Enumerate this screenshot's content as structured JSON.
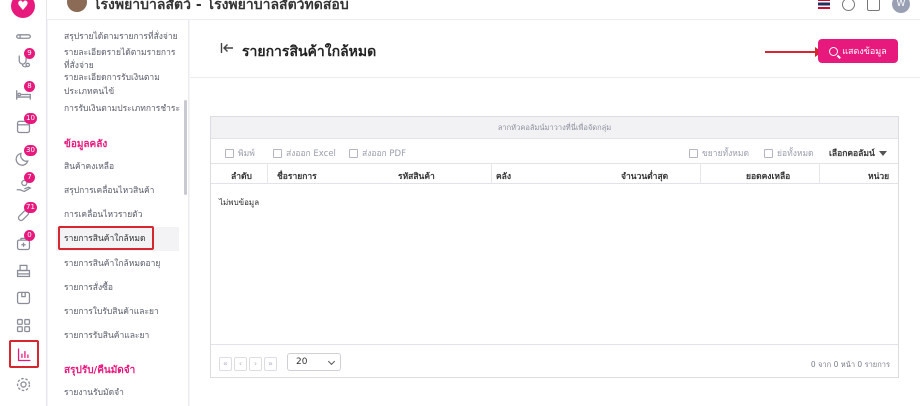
{
  "topbar": {
    "hospital_title": "โรงพยาบาลสัตว์ - โรงพยาบาลสัตว์ทดสอบ",
    "user_initial": "W"
  },
  "rail": {
    "badges": [
      "9",
      "8",
      "10",
      "30",
      "7",
      "71",
      "0"
    ]
  },
  "menu": {
    "items_top": [
      "สรุปรายได้ตามรายการที่สั่งจ่าย",
      "รายละเอียดรายได้ตามรายการ",
      "ที่สั่งจ่าย",
      "รายละเอียดการรับเงินตาม",
      "ประเภทคนไข้",
      "การรับเงินตามประเภทการชำระ"
    ],
    "section1_title": "ข้อมูลคลัง",
    "section1_items": [
      "สินค้าคงเหลือ",
      "สรุปการเคลื่อนไหวสินค้า",
      "การเคลื่อนไหวรายตัว",
      "รายการสินค้าใกล้หมด",
      "รายการสินค้าใกล้หมดอายุ",
      "รายการสั่งซื้อ",
      "รายการใบรับสินค้าและยา",
      "รายการรับสินค้าและยา"
    ],
    "section2_title": "สรุปรับ/คืนมัดจำ",
    "section2_items": [
      "รายงานรับมัดจำ"
    ]
  },
  "page": {
    "title": "รายการสินค้าใกล้หมด",
    "show_button": "แสดงข้อมูล"
  },
  "grid": {
    "group_hint": "ลากหัวคอลัมน์มาวางที่นี่เพื่อจัดกลุ่ม",
    "toolbar": {
      "print": "พิมพ์",
      "export_excel": "ส่งออก Excel",
      "export_pdf": "ส่งออก PDF",
      "expand_all": "ขยายทั้งหมด",
      "collapse_all": "ย่อทั้งหมด",
      "choose_columns": "เลือกคอลัมน์"
    },
    "columns": [
      "ลำดับ",
      "ชื่อรายการ",
      "รหัสสินค้า",
      "คลัง",
      "จำนวนต่ำสุด",
      "ยอดคงเหลือ",
      "หน่วย"
    ],
    "no_data": "ไม่พบข้อมูล",
    "pager": {
      "first": "«",
      "prev": "‹",
      "next": "›",
      "last": "»",
      "page_size": "20",
      "info": "0 จาก 0 หน้า 0 รายการ"
    }
  },
  "colors": {
    "accent": "#e8197d",
    "highlight_border": "#d6262f"
  }
}
